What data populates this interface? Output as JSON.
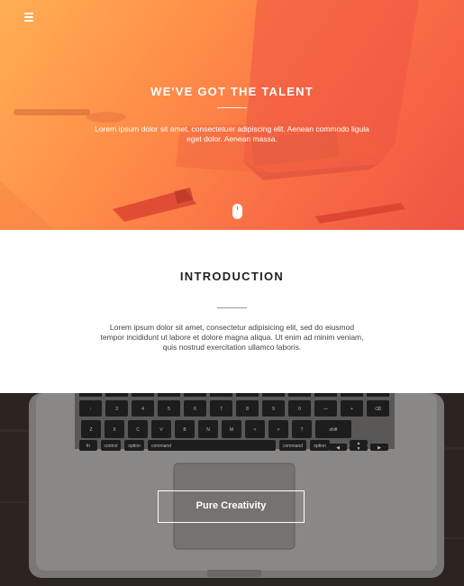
{
  "hero": {
    "menu_icon": "hamburger-menu-icon",
    "title": "WE'VE GOT THE TALENT",
    "text": "Lorem ipsum dolor sit amet, consectetuer adipiscing elit. Aenean commodo ligula eget dolor. Aenean massa.",
    "scroll_icon": "mouse-scroll-icon",
    "gradient_colors": [
      "#ffae52",
      "#ff8e48",
      "#f86a45",
      "#ee5443"
    ]
  },
  "intro": {
    "title": "INTRODUCTION",
    "text": "Lorem ipsum dolor sit amet, consectetur adipisicing elit, sed do eiusmod tempor incididunt ut labore et dolore magna aliqua. Ut enim ad minim veniam, quis nostrud exercitation ullamco laboris."
  },
  "keyboard": {
    "row1": [
      "↑",
      "3",
      "4",
      "5",
      "6",
      "7",
      "8",
      "9",
      "0",
      "—",
      "+",
      "⌫"
    ],
    "row2": [
      "Z",
      "X",
      "C",
      "V",
      "B",
      "N",
      "M",
      "<",
      ">",
      "?",
      "shift"
    ],
    "row3": [
      "fn",
      "control",
      "option",
      "command",
      "command",
      "option"
    ]
  },
  "cta": {
    "label": "Pure Creativity"
  }
}
